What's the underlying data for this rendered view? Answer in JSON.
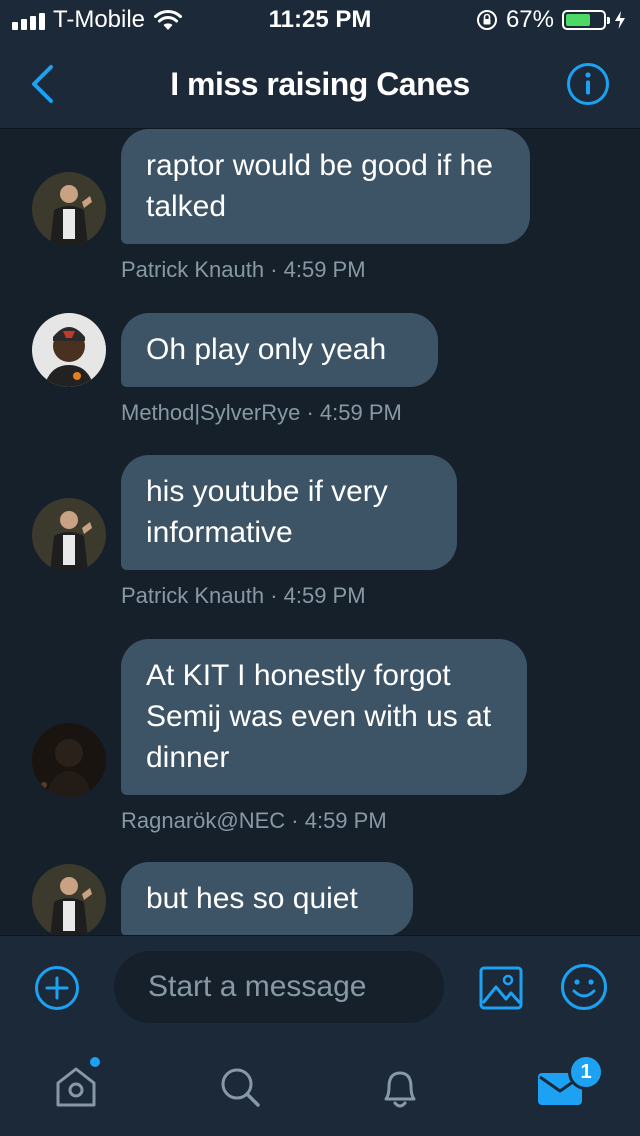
{
  "status_bar": {
    "carrier": "T-Mobile",
    "time": "11:25 PM",
    "battery": "67%",
    "battery_level": 0.67
  },
  "header": {
    "title": "I miss raising Canes",
    "back_icon": "chevron-left-icon",
    "info_icon": "info-icon"
  },
  "messages": [
    {
      "text": "raptor would be good if he talked",
      "meta": "Patrick Knauth · 4:59 PM"
    },
    {
      "text": "Oh play only yeah",
      "meta": "Method|SylverRye · 4:59 PM"
    },
    {
      "text": "his youtube if very informative",
      "meta": "Patrick Knauth · 4:59 PM"
    },
    {
      "text": "At KIT I honestly forgot Semij was even with us at dinner",
      "meta": "Ragnarök@NEC · 4:59 PM"
    },
    {
      "text": "but hes so quiet",
      "meta": ""
    }
  ],
  "composer": {
    "placeholder": "Start a message"
  },
  "tabbar": {
    "messages_badge": "1"
  },
  "colors": {
    "background": "#15202b",
    "bar": "#1c2938",
    "bubble": "#3d5466",
    "accent": "#1da1f2",
    "meta_text": "#8899a6"
  }
}
